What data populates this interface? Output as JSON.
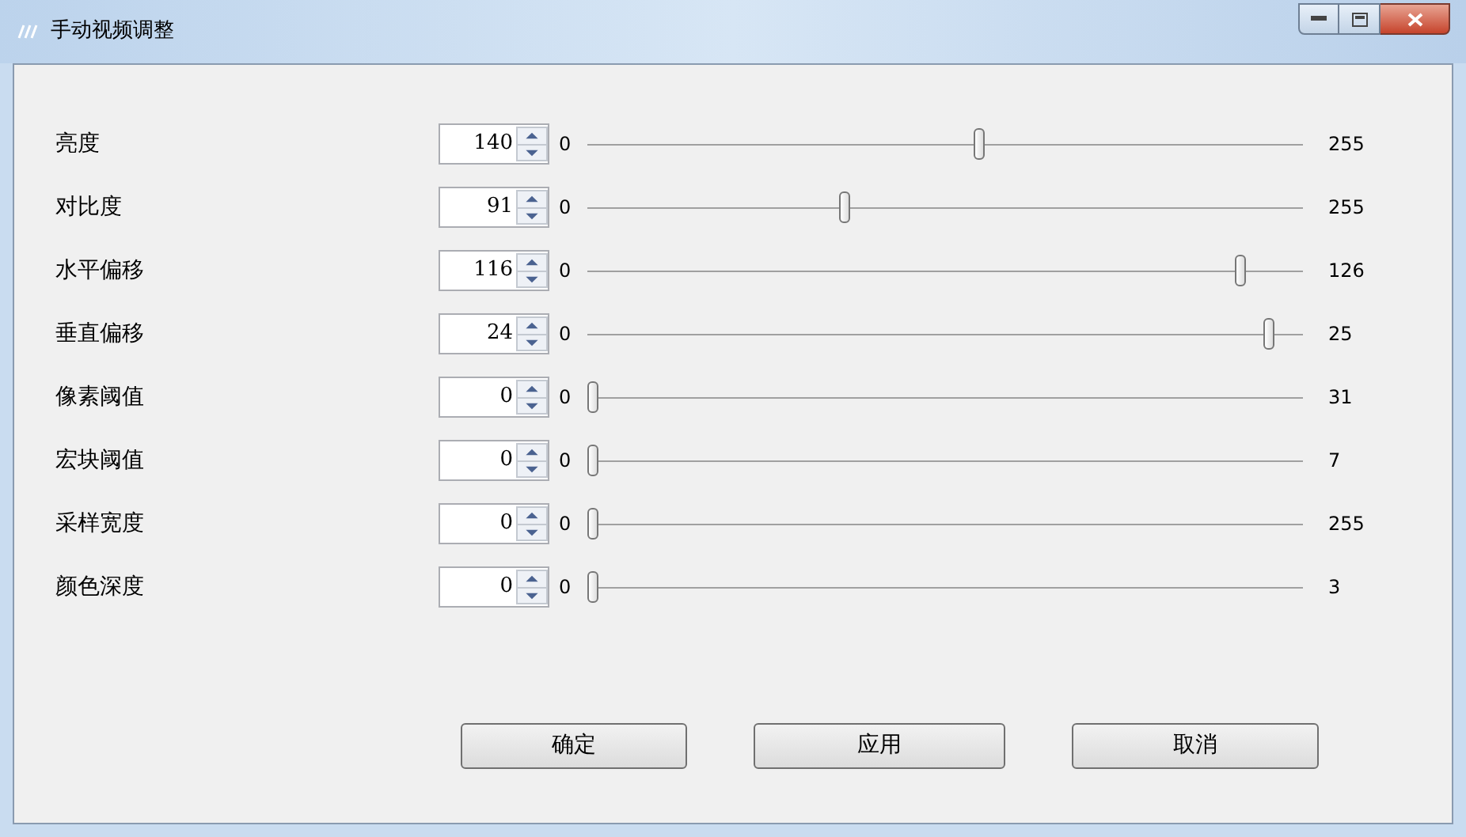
{
  "window": {
    "title": "手动视频调整"
  },
  "rows": [
    {
      "label": "亮度",
      "value": "140",
      "min": "0",
      "max": "255",
      "level": 0.549
    },
    {
      "label": "对比度",
      "value": "91",
      "min": "0",
      "max": "255",
      "level": 0.357
    },
    {
      "label": "水平偏移",
      "value": "116",
      "min": "0",
      "max": "126",
      "level": 0.92
    },
    {
      "label": "垂直偏移",
      "value": "24",
      "min": "0",
      "max": "25",
      "level": 0.96
    },
    {
      "label": "像素阈值",
      "value": "0",
      "min": "0",
      "max": "31",
      "level": 0
    },
    {
      "label": "宏块阈值",
      "value": "0",
      "min": "0",
      "max": "7",
      "level": 0
    },
    {
      "label": "采样宽度",
      "value": "0",
      "min": "0",
      "max": "255",
      "level": 0
    },
    {
      "label": "颜色深度",
      "value": "0",
      "min": "0",
      "max": "3",
      "level": 0
    }
  ],
  "buttons": [
    "确定",
    "应用",
    "取消"
  ]
}
